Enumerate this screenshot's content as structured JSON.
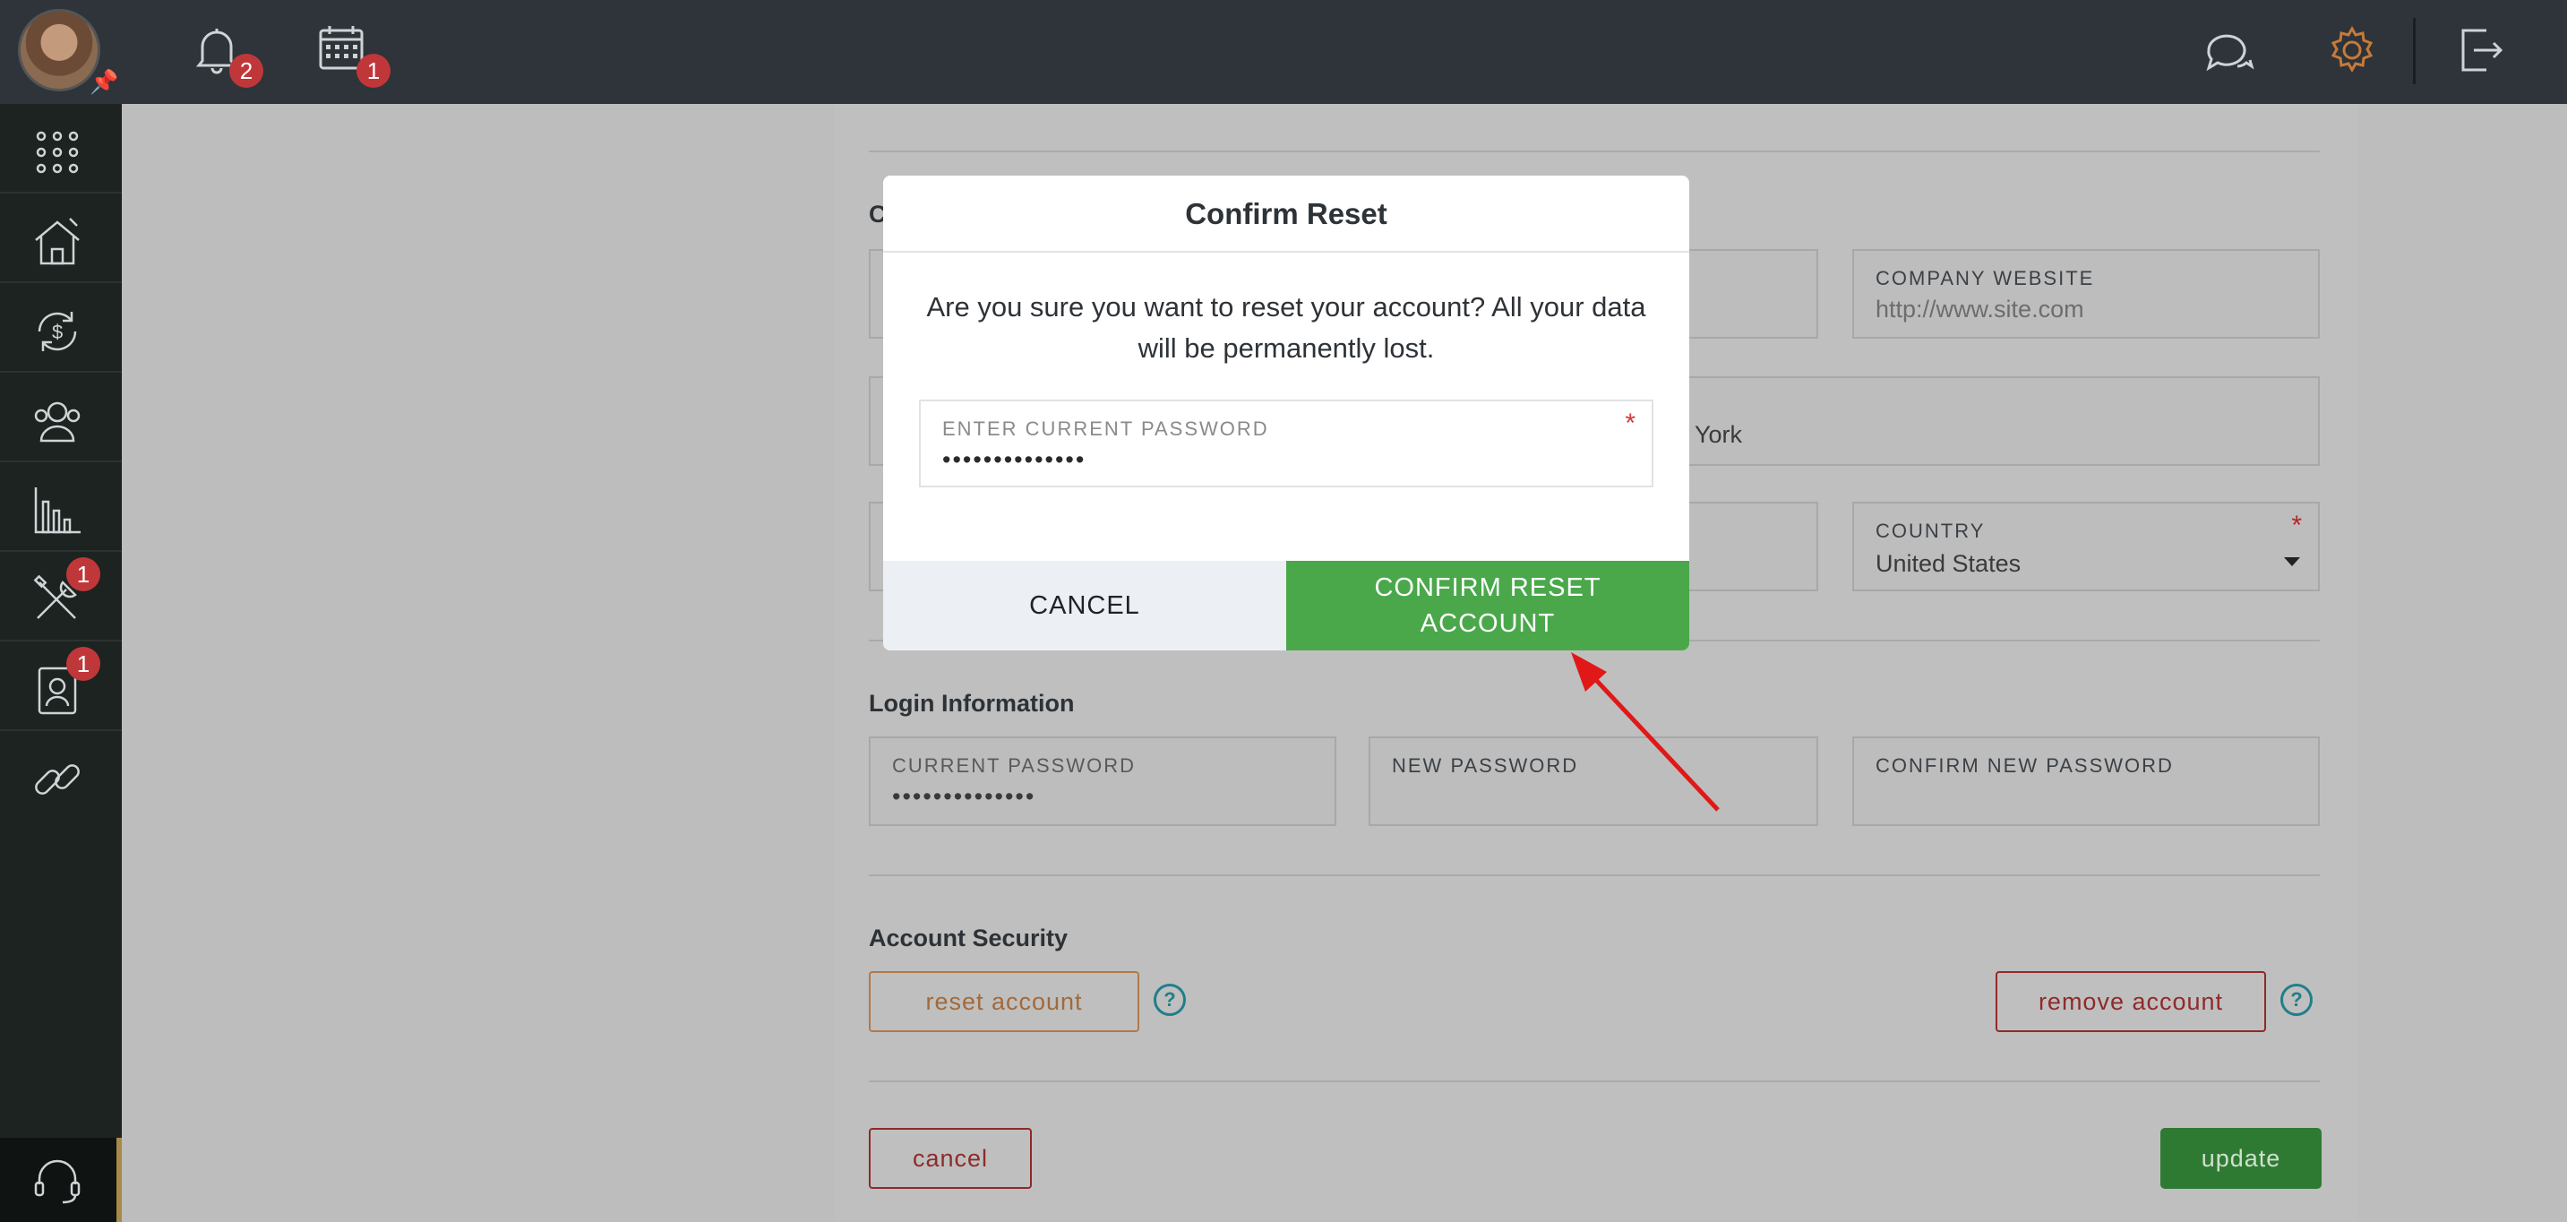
{
  "topbar": {
    "notifications_badge": "2",
    "calendar_badge": "1"
  },
  "sidebar": {
    "tools_badge": "1",
    "contacts_badge": "1"
  },
  "company": {
    "website_label": "COMPANY WEBSITE",
    "website_placeholder": "http://www.site.com",
    "city_partial": "York",
    "country_label": "COUNTRY",
    "country_value": "United States",
    "section_partial": "C"
  },
  "login": {
    "title": "Login Information",
    "current_password_label": "CURRENT PASSWORD",
    "current_password_value": "••••••••••••••",
    "new_password_label": "NEW PASSWORD",
    "confirm_new_password_label": "CONFIRM NEW PASSWORD"
  },
  "security": {
    "title": "Account Security",
    "reset_label": "reset account",
    "remove_label": "remove account",
    "help_glyph": "?"
  },
  "footer": {
    "cancel_label": "cancel",
    "update_label": "update"
  },
  "modal": {
    "title": "Confirm Reset",
    "message": "Are you sure you want to reset your account? All your data will be permanently lost.",
    "password_label": "ENTER CURRENT PASSWORD",
    "password_value": "••••••••••••••",
    "required_mark": "*",
    "cancel_label": "CANCEL",
    "confirm_label": "CONFIRM RESET ACCOUNT"
  },
  "colors": {
    "topbar": "#2e3439",
    "sidebar": "#1c2320",
    "confirm_green": "#4aa84b",
    "badge_red": "#c0373a",
    "settings_orange": "#c77a3a"
  }
}
